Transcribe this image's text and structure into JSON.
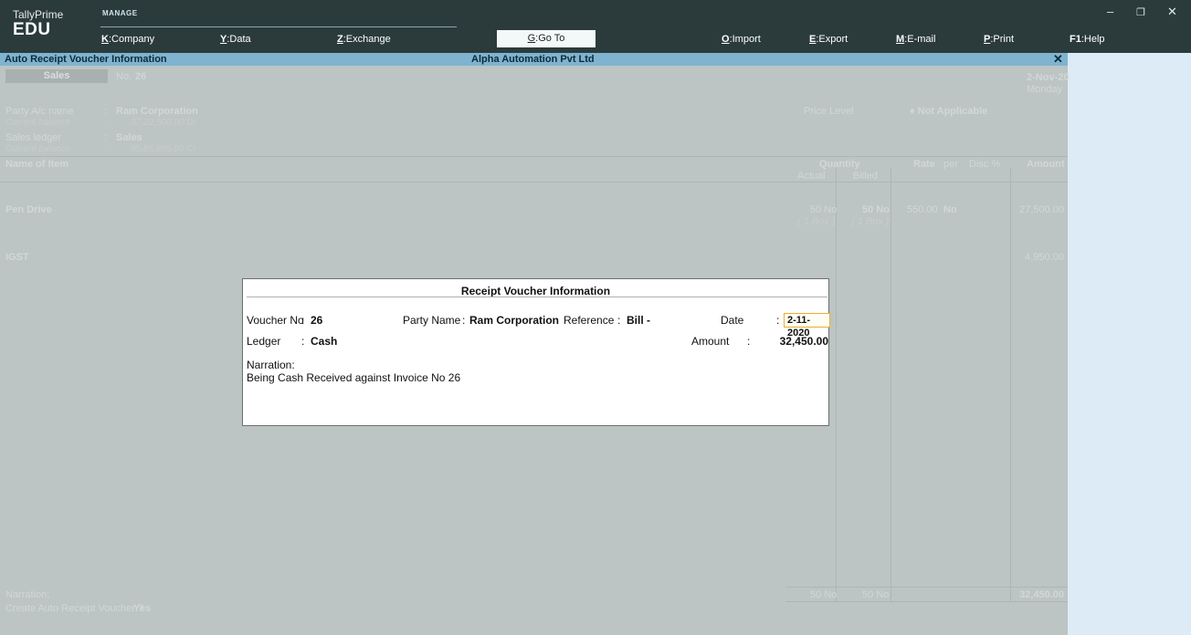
{
  "app": {
    "name": "TallyPrime",
    "edition": "EDU",
    "section": "MANAGE"
  },
  "menu": [
    {
      "key": "K",
      "label": "Company"
    },
    {
      "key": "Y",
      "label": "Data"
    },
    {
      "key": "Z",
      "label": "Exchange"
    },
    {
      "key": "G",
      "label": "Go To"
    },
    {
      "key": "O",
      "label": "Import"
    },
    {
      "key": "E",
      "label": "Export"
    },
    {
      "key": "M",
      "label": "E-mail"
    },
    {
      "key": "P",
      "label": "Print"
    },
    {
      "key": "F1",
      "label": "Help"
    }
  ],
  "window_controls": {
    "minimize": "–",
    "restore": "❐",
    "close": "✕"
  },
  "titlebar": {
    "left": "Auto Receipt Voucher Information",
    "center": "Alpha Automation Pvt Ltd",
    "close": "✕"
  },
  "voucher": {
    "type": "Sales",
    "no_label": "No.",
    "no": "26",
    "date": "2-Nov-20",
    "day": "Monday",
    "party_label": "Party A/c name",
    "party": "Ram Corporation",
    "cur_bal_label": "Current balance",
    "party_balance": "37,22,500.00 Dr",
    "sales_label": "Sales ledger",
    "sales": "Sales",
    "sales_balance": "85,85,865.00 Cr",
    "price_level_label": "Price Level",
    "price_level": "♦ Not Applicable",
    "colon": ":",
    "columns": {
      "item": "Name of Item",
      "quantity": "Quantity",
      "actual": "Actual",
      "billed": "Billed",
      "rate": "Rate",
      "per": "per",
      "disc": "Disc %",
      "amount": "Amount"
    },
    "item": {
      "name": "Pen Drive",
      "actual": "50 No",
      "billed": "50 No",
      "actual_alt": "( 1 Box )",
      "billed_alt": "( 1 Box )",
      "rate": "550.00",
      "per": "No",
      "amount": "27,500.00"
    },
    "tax": {
      "name": "IGST",
      "amount": "4,950.00"
    },
    "narration_label": "Narration:",
    "auto_receipt_label": "Create Auto Receipt Voucher ?",
    "auto_receipt_value": "Yes",
    "totals": {
      "actual": "50 No",
      "billed": "50 No",
      "amount": "32,450.00"
    }
  },
  "popup": {
    "title": "Receipt Voucher Information",
    "voucher_no_label": "Voucher No",
    "voucher_no": "26",
    "party_label": "Party Name",
    "party": "Ram Corporation",
    "reference_label": "Reference",
    "reference": "Bill -",
    "date_label": "Date",
    "date": "2-11-2020",
    "ledger_label": "Ledger",
    "ledger": "Cash",
    "amount_label": "Amount",
    "amount": "32,450.00",
    "narration_label": "Narration:",
    "narration": "Being Cash Received against Invoice No 26",
    "colon": ":"
  }
}
